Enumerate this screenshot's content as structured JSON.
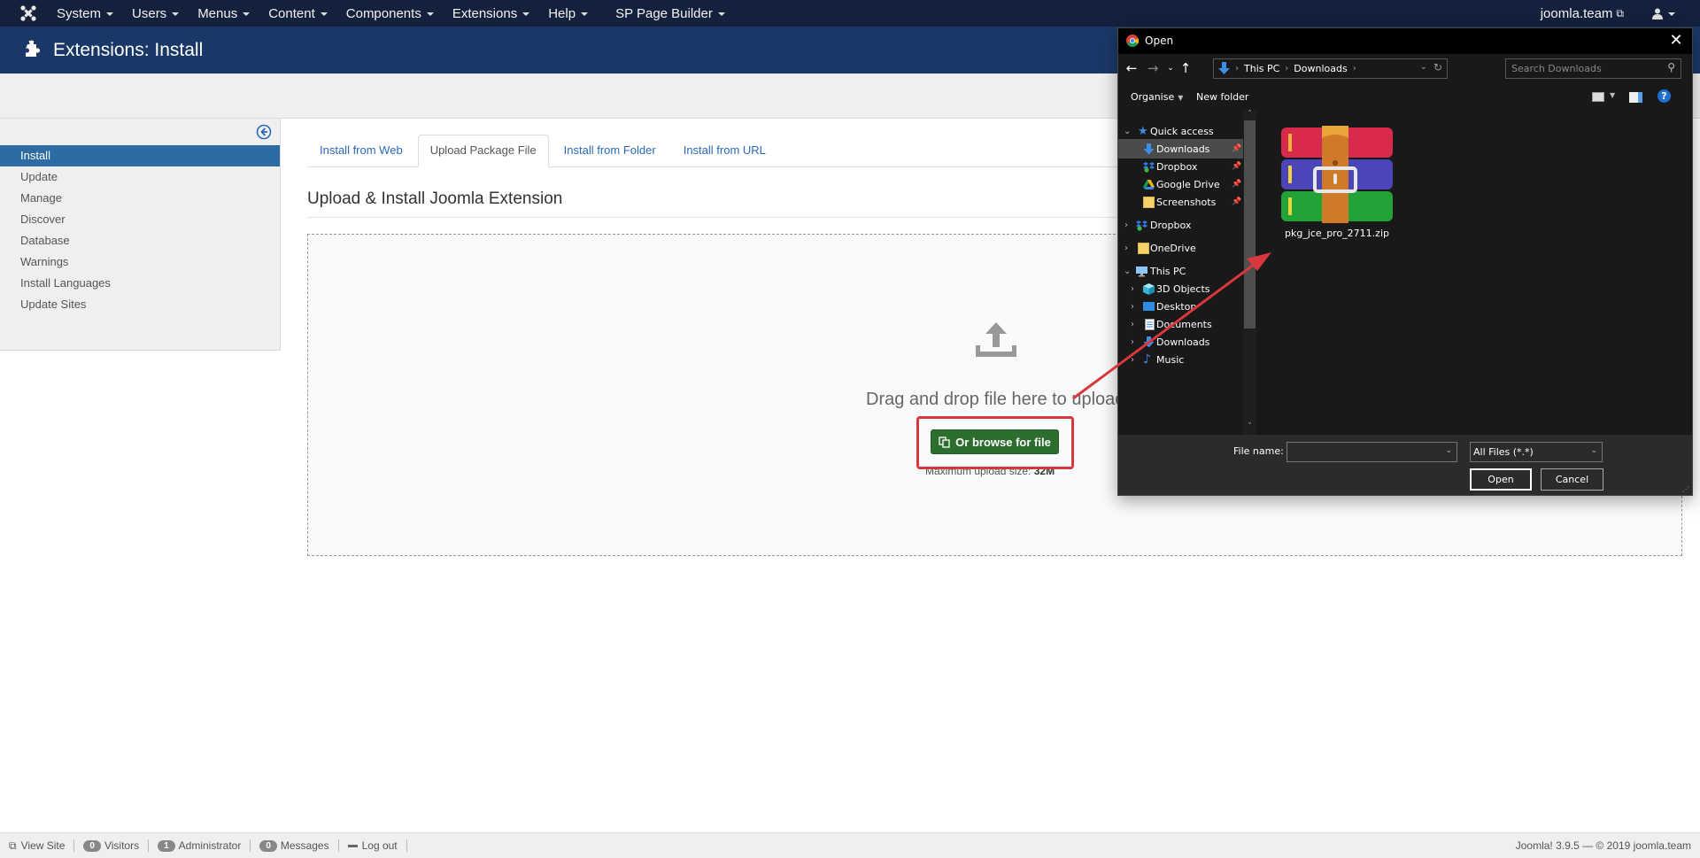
{
  "topnav": {
    "menu": [
      {
        "label": "System"
      },
      {
        "label": "Users"
      },
      {
        "label": "Menus"
      },
      {
        "label": "Content"
      },
      {
        "label": "Components"
      },
      {
        "label": "Extensions"
      },
      {
        "label": "Help"
      },
      {
        "label": "SP Page Builder"
      }
    ],
    "site_link": "joomla.team"
  },
  "header": {
    "title": "Extensions: Install"
  },
  "sidebar": {
    "items": [
      {
        "label": "Install",
        "active": true
      },
      {
        "label": "Update"
      },
      {
        "label": "Manage"
      },
      {
        "label": "Discover"
      },
      {
        "label": "Database"
      },
      {
        "label": "Warnings"
      },
      {
        "label": "Install Languages"
      },
      {
        "label": "Update Sites"
      }
    ]
  },
  "tabs": [
    {
      "label": "Install from Web"
    },
    {
      "label": "Upload Package File",
      "active": true
    },
    {
      "label": "Install from Folder"
    },
    {
      "label": "Install from URL"
    }
  ],
  "main": {
    "section_title": "Upload & Install Joomla Extension",
    "drag_text": "Drag and drop file here to upload.",
    "browse_button": "Or browse for file",
    "max_upload_label": "Maximum upload size:",
    "max_upload_value": "32M"
  },
  "statusbar": {
    "view_site": "View Site",
    "visitors_count": "0",
    "visitors_label": "Visitors",
    "admin_count": "1",
    "admin_label": "Administrator",
    "messages_count": "0",
    "messages_label": "Messages",
    "logout": "Log out",
    "version": "Joomla! 3.9.5  —  © 2019 joomla.team"
  },
  "dialog": {
    "title": "Open",
    "close": "✕",
    "breadcrumb": [
      "This PC",
      "Downloads"
    ],
    "search_placeholder": "Search Downloads",
    "organise": "Organise",
    "new_folder": "New folder",
    "help": "?",
    "nav": [
      {
        "label": "Quick access",
        "icon": "star-icon",
        "expanded": true
      },
      {
        "label": "Downloads",
        "icon": "download-arrow-icon",
        "pinned": true,
        "selected": true
      },
      {
        "label": "Dropbox",
        "icon": "dropbox-icon",
        "pinned": true
      },
      {
        "label": "Google Drive",
        "icon": "google-drive-icon",
        "pinned": true
      },
      {
        "label": "Screenshots",
        "icon": "folder-icon",
        "pinned": true
      },
      {
        "label": "Dropbox",
        "icon": "dropbox-icon"
      },
      {
        "label": "OneDrive",
        "icon": "folder-icon"
      },
      {
        "label": "This PC",
        "icon": "computer-icon",
        "expanded": true
      },
      {
        "label": "3D Objects",
        "icon": "cube-icon"
      },
      {
        "label": "Desktop",
        "icon": "desktop-icon"
      },
      {
        "label": "Documents",
        "icon": "document-icon"
      },
      {
        "label": "Downloads",
        "icon": "download-arrow-icon"
      },
      {
        "label": "Music",
        "icon": "music-icon"
      }
    ],
    "files": [
      {
        "name": "pkg_jce_pro_2711.zip",
        "icon": "winrar-archive-icon"
      }
    ],
    "file_name_label": "File name:",
    "file_name_value": "",
    "file_type": "All Files (*.*)",
    "open_button": "Open",
    "cancel_button": "Cancel"
  },
  "annotation": {
    "color": "#d9363e"
  }
}
